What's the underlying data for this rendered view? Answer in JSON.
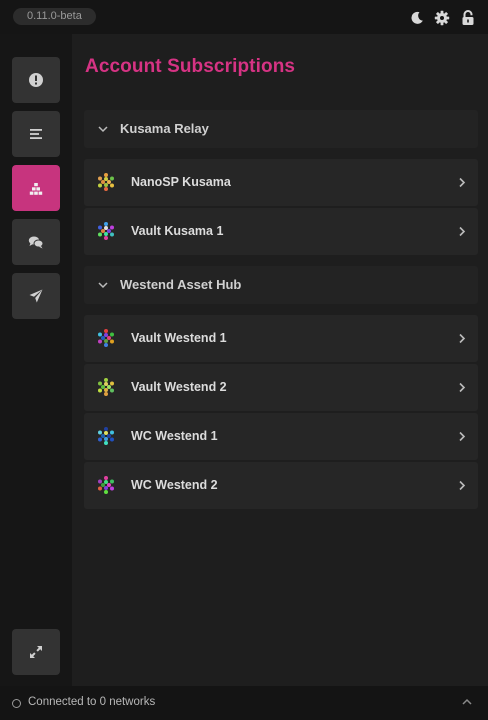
{
  "app": {
    "version": "0.11.0-beta"
  },
  "topbar": {
    "icons": [
      "moon-icon",
      "gear-icon",
      "unlock-icon"
    ]
  },
  "sidebar": {
    "items": [
      {
        "icon": "info-icon",
        "active": false
      },
      {
        "icon": "list-icon",
        "active": false
      },
      {
        "icon": "subscriptions-icon",
        "active": true
      },
      {
        "icon": "chat-icon",
        "active": false
      },
      {
        "icon": "paper-plane-icon",
        "active": false
      }
    ],
    "bottom_icon": "expand-icon"
  },
  "main": {
    "title": "Account Subscriptions",
    "groups": [
      {
        "title": "Kusama Relay",
        "accounts": [
          {
            "name": "NanoSP Kusama",
            "icon": "identicon"
          },
          {
            "name": "Vault Kusama 1",
            "icon": "identicon"
          }
        ]
      },
      {
        "title": "Westend Asset Hub",
        "accounts": [
          {
            "name": "Vault Westend 1",
            "icon": "identicon"
          },
          {
            "name": "Vault Westend 2",
            "icon": "identicon"
          },
          {
            "name": "WC Westend 1",
            "icon": "identicon"
          },
          {
            "name": "WC Westend 2",
            "icon": "identicon"
          }
        ]
      }
    ]
  },
  "status": {
    "text": "Connected to 0 networks"
  },
  "colors": {
    "accent": "#d63384",
    "active_nav": "#c7347e",
    "background": "#1e1e1e",
    "row": "#262626"
  }
}
